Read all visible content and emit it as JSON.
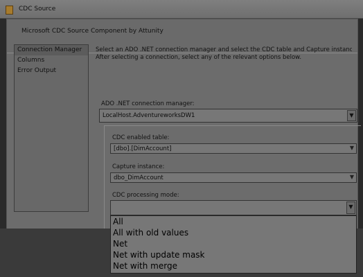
{
  "window": {
    "title": "CDC Source"
  },
  "header": {
    "title": "Microsoft CDC Source Component by Attunity"
  },
  "nav": {
    "items": [
      "Connection Manager",
      "Columns",
      "Error Output"
    ]
  },
  "main": {
    "instructions_line1": "Select an ADO .NET connection manager and select the CDC table and Capture instance whe",
    "instructions_line2": "After selecting a connection, select any of the relevant options below.",
    "connection_label": "ADO .NET connection manager:",
    "connection_value": "LocalHost.AdventureworksDW1",
    "cdc_table_label": "CDC enabled table:",
    "cdc_table_value": "[dbo].[DimAccount]",
    "capture_label": "Capture instance:",
    "capture_value": "dbo_DimAccount",
    "processing_label": "CDC processing mode:",
    "processing_value": ""
  },
  "dropdown": {
    "options": [
      "All",
      "All with old values",
      "Net",
      "Net with update mask",
      "Net with merge"
    ]
  },
  "icons": {
    "app": "cdc-source-app-icon",
    "combo_arrow": "chevron-down-icon"
  }
}
